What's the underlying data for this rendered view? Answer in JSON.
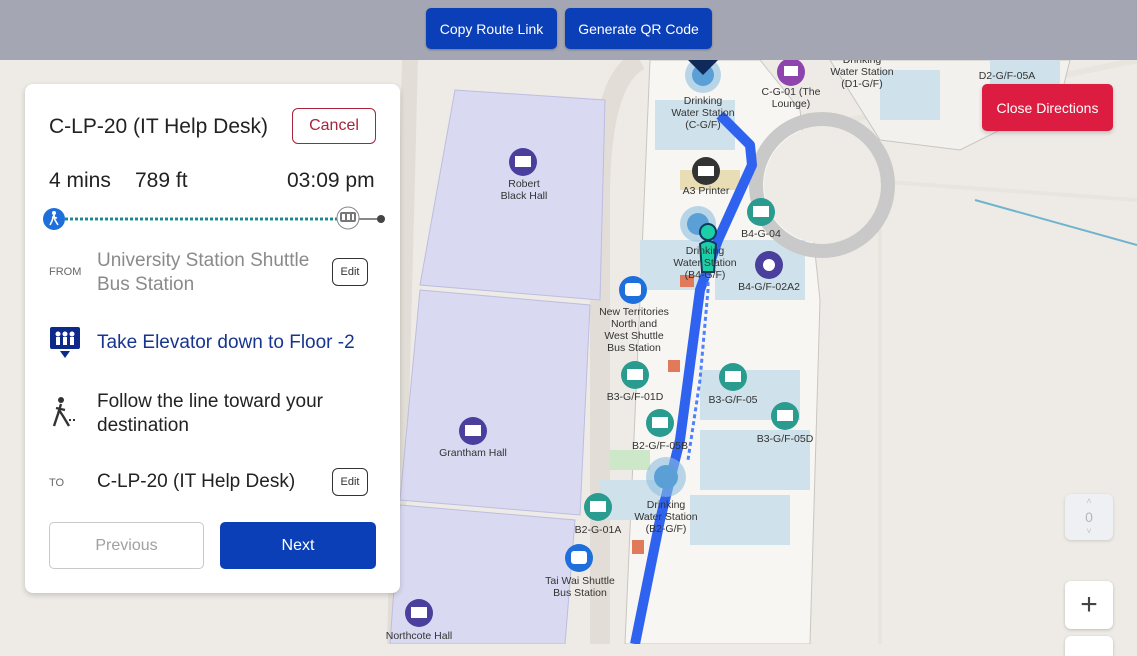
{
  "toolbar": {
    "copy_link": "Copy Route Link",
    "qr_code": "Generate QR Code"
  },
  "close_directions": "Close Directions",
  "panel": {
    "destination": "C-LP-20 (IT Help Desk)",
    "cancel": "Cancel",
    "duration": "4 mins",
    "distance": "789 ft",
    "arrival": "03:09 pm",
    "from_label": "FROM",
    "from_value": "University Station Shuttle Bus Station",
    "edit_label": "Edit",
    "step_elevator": "Take Elevator down to Floor -2",
    "step_follow": "Follow the line toward your destination",
    "to_label": "TO",
    "to_value": "C-LP-20 (IT Help Desk)",
    "prev": "Previous",
    "next": "Next"
  },
  "floor_control": {
    "value": "0"
  },
  "zoom_in": "+",
  "map": {
    "labels": {
      "robert_black_hall": "Robert Black Hall",
      "grantham_hall": "Grantham Hall",
      "northcote_hall": "Northcote Hall",
      "water_cgf": [
        "Drinking",
        "Water Station",
        "(C-G/F)"
      ],
      "cg01": [
        "C-G-01 (The",
        "Lounge)"
      ],
      "water_d1": [
        "Drinking",
        "Water Station",
        "(D1-G/F)"
      ],
      "d2": "D2-G/F-05A",
      "a3_printer": "A3 Printer",
      "b4g04": "B4-G-04",
      "water_b4": [
        "Drinking",
        "Water Station",
        "(B4-G/F)"
      ],
      "b4g02a2": "B4-G/F-02A2",
      "nt_shuttle": [
        "New Territories",
        "North and",
        "West Shuttle",
        "Bus Station"
      ],
      "b3g01d": "B3-G/F-01D",
      "b3g05": "B3-G/F-05",
      "b3g05d": "B3-G/F-05D",
      "b2g05b": "B2-G/F-05B",
      "water_b2": [
        "Drinking",
        "Water Station",
        "(B2-G/F)"
      ],
      "b2g01a": "B2-G-01A",
      "taiwai": [
        "Tai Wai Shuttle",
        "Bus Station"
      ]
    }
  },
  "colors": {
    "primary": "#0b3fb8",
    "danger": "#dc1c40",
    "route": "#2f63ef",
    "poi_teal": "#2a9b8f",
    "poi_blue": "#1e6fdc",
    "poi_purple": "#4a3f9c"
  }
}
